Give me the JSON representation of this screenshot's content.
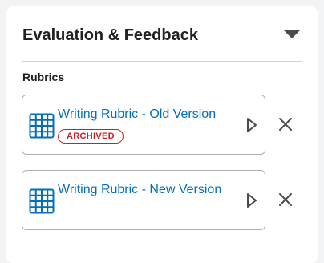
{
  "panel": {
    "title": "Evaluation & Feedback",
    "toggle_icon": "caret-down-icon"
  },
  "rubrics": {
    "label": "Rubrics",
    "items": [
      {
        "title": "Writing Rubric - Old Version",
        "badge": "ARCHIVED",
        "icon": "rubric-grid-icon"
      },
      {
        "title": "Writing Rubric - New Version",
        "icon": "rubric-grid-icon"
      }
    ]
  },
  "colors": {
    "link": "#006fbf",
    "archived": "#cd2026",
    "border": "#a9b1b9",
    "icon": "#006fbf"
  }
}
